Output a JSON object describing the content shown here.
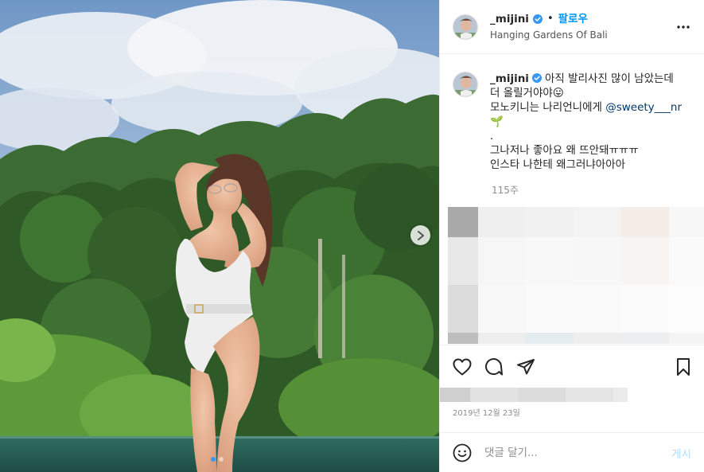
{
  "post": {
    "username": "_mijini",
    "header_separator": "•",
    "follow_label": "팔로우",
    "location": "Hanging Gardens Of Bali",
    "caption_lines": [
      "아직 발리사진 많이 남았는데",
      "더 올릴거야야😛",
      "모노키니는 나리언니에게 ",
      "🌱",
      ".",
      "그나저나 좋아요 왜 뜨안돼ㅠㅠㅠ",
      "인스타 나한테 왜그러냐아아아"
    ],
    "mention": "@sweety___nr",
    "time_ago": "115주",
    "date": "2019년 12월 23일",
    "comment_placeholder": "댓글 달기...",
    "post_button": "게시",
    "carousel": {
      "total": 2,
      "current": 1
    }
  },
  "icons": {
    "verified": "verified-badge-icon",
    "more": "more-options-icon",
    "like": "heart-icon",
    "comment": "comment-icon",
    "share": "paper-plane-icon",
    "save": "bookmark-icon",
    "emoji": "emoji-icon",
    "next": "chevron-right-icon"
  },
  "colors": {
    "accent": "#0095f6",
    "verified": "#3897f0",
    "mention": "#00376b",
    "muted": "#8e8e8e",
    "post_button_disabled": "#b2dffc"
  }
}
